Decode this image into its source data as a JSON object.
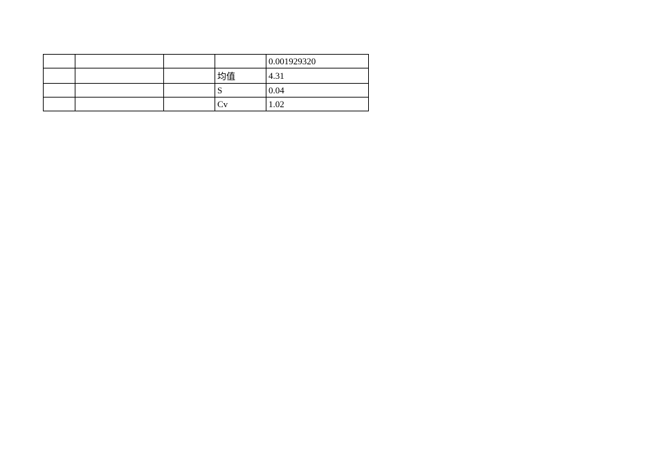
{
  "table": {
    "rows": [
      {
        "c1": "",
        "c2": "",
        "c3": "",
        "c4": "",
        "c5": "0.001929320"
      },
      {
        "c1": "",
        "c2": "",
        "c3": "",
        "c4": "均值",
        "c5": "4.31"
      },
      {
        "c1": "",
        "c2": "",
        "c3": "",
        "c4": "S",
        "c5": "0.04"
      },
      {
        "c1": "",
        "c2": "",
        "c3": "",
        "c4": "Cv",
        "c5": "1.02"
      }
    ]
  }
}
